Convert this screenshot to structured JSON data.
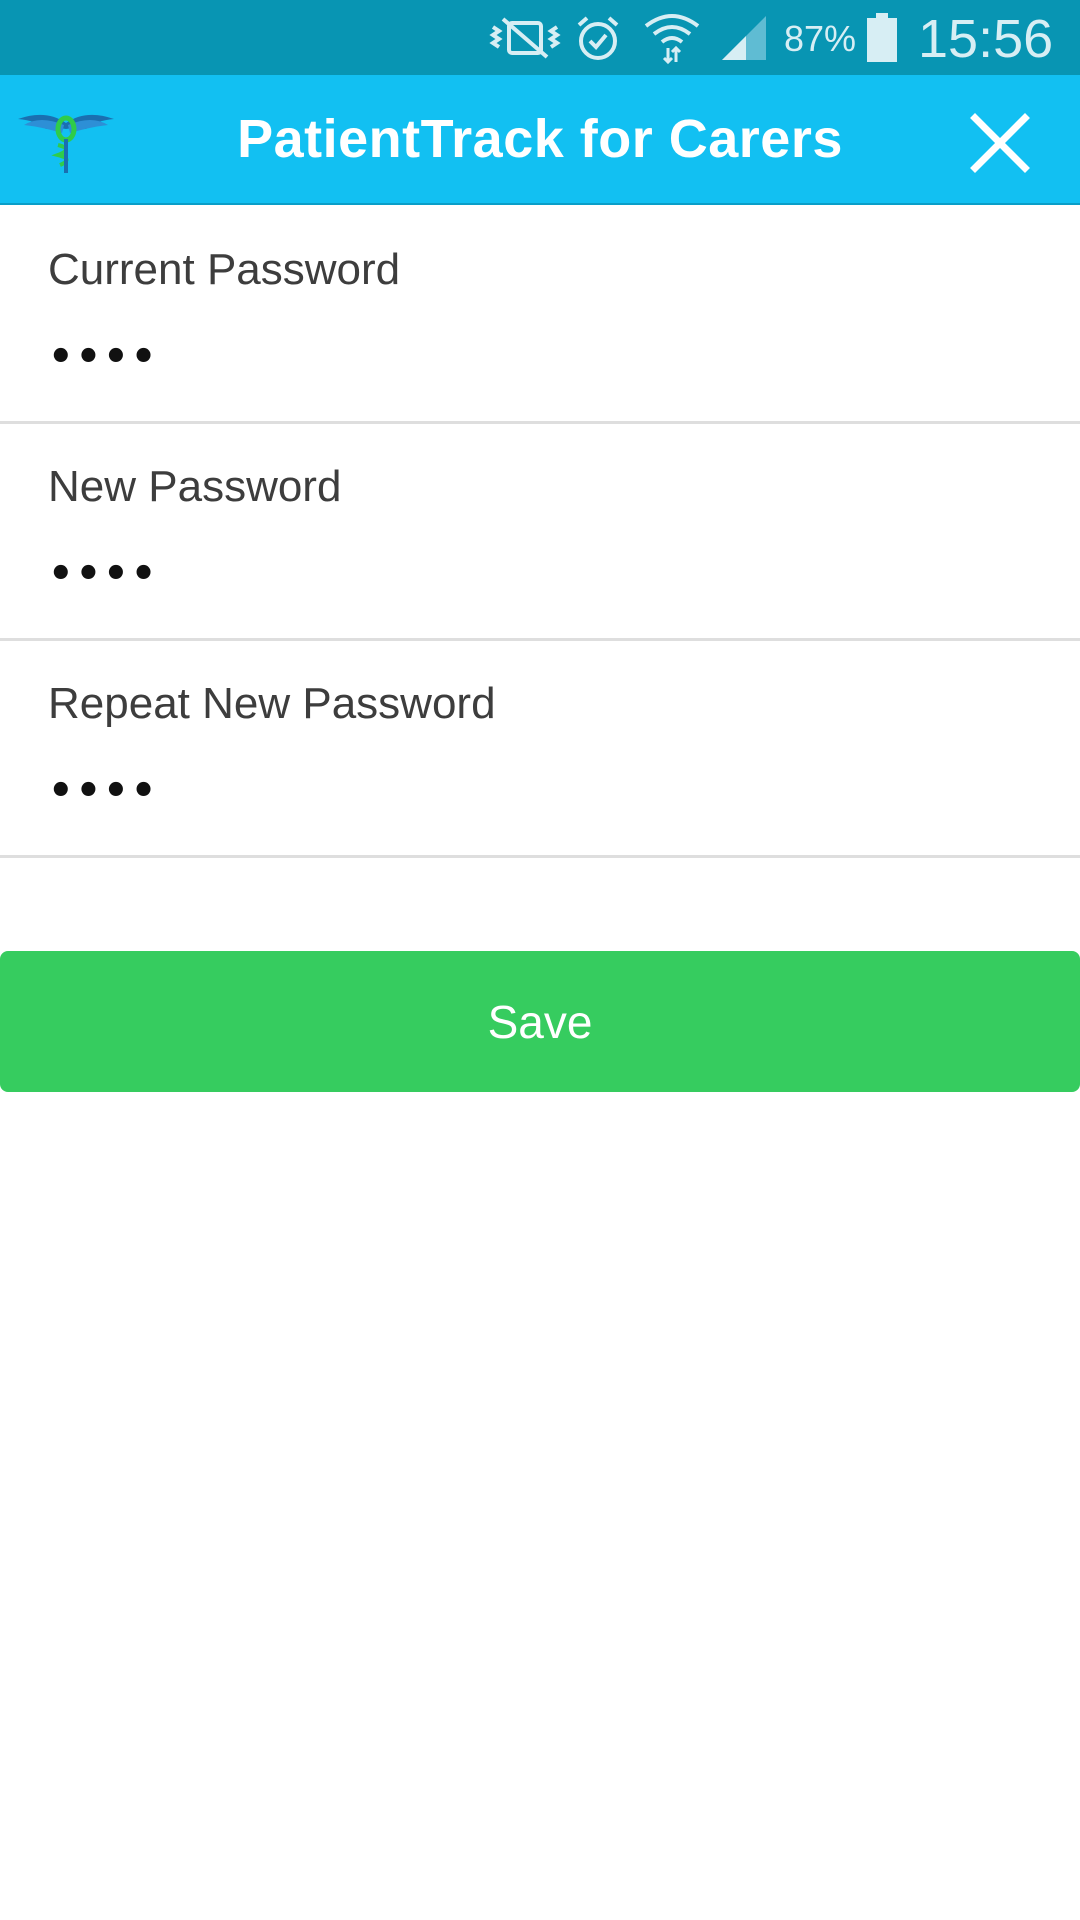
{
  "status_bar": {
    "icons": [
      "mute-vibrate-icon",
      "alarm-icon",
      "wifi-icon",
      "cell-signal-icon",
      "battery-icon"
    ],
    "battery_percent": "87%",
    "time": "15:56",
    "background_color": "#0895b3"
  },
  "app_bar": {
    "title": "PatientTrack for Carers",
    "logo_icon": "caduceus-logo-icon",
    "close_icon": "close-icon",
    "background_color": "#12c0f2"
  },
  "form": {
    "fields": [
      {
        "label": "Current Password",
        "value": "••••"
      },
      {
        "label": "New Password",
        "value": "••••"
      },
      {
        "label": "Repeat New Password",
        "value": "••••"
      }
    ]
  },
  "save_button": {
    "label": "Save",
    "color": "#36cc5f"
  }
}
